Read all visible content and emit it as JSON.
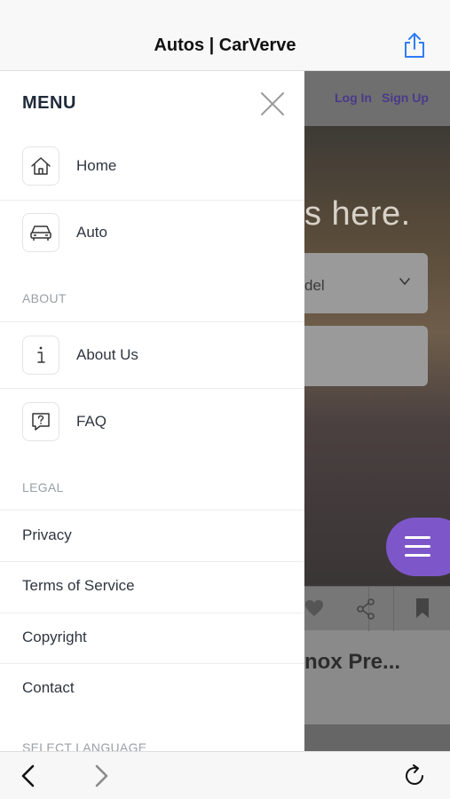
{
  "browser": {
    "title": "Autos | CarVerve",
    "share_icon": "share-icon",
    "back_icon": "back-arrow-icon",
    "forward_icon": "forward-arrow-icon",
    "reload_icon": "reload-icon"
  },
  "background_page": {
    "login_label": "Log In",
    "signup_label": "Sign Up",
    "hero_text": "s here.",
    "select_value": "del",
    "article_title": "nox Pre..."
  },
  "menu": {
    "title": "MENU",
    "main_items": [
      {
        "label": "Home",
        "icon": "home-icon"
      },
      {
        "label": "Auto",
        "icon": "car-icon"
      }
    ],
    "about_section": "ABOUT",
    "about_items": [
      {
        "label": "About Us",
        "icon": "info-icon"
      },
      {
        "label": "FAQ",
        "icon": "question-icon"
      }
    ],
    "legal_section": "LEGAL",
    "legal_items": [
      "Privacy",
      "Terms of Service",
      "Copyright",
      "Contact"
    ],
    "language_section": "SELECT LANGUAGE"
  },
  "colors": {
    "accent": "#7d57c9",
    "link": "#4a3a8a",
    "menu_text": "#2f3640",
    "section_label": "#9aa0a6"
  }
}
